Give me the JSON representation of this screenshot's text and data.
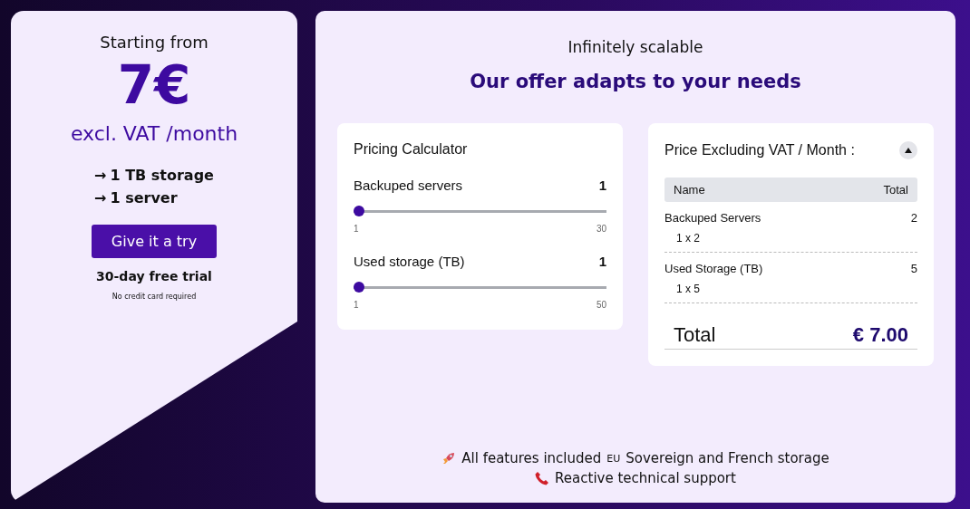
{
  "offer_card": {
    "intro": "Starting from",
    "price": "7€",
    "period": "excl. VAT /month",
    "features": [
      {
        "arrow": "→",
        "text": "1 TB storage"
      },
      {
        "arrow": "→",
        "text": "1 server"
      }
    ],
    "button": "Give it a try",
    "trial": "30-day free trial",
    "note": "No credit card required"
  },
  "main": {
    "subtitle": "Infinitely scalable",
    "title": "Our offer adapts to your needs"
  },
  "calculator": {
    "title": "Pricing Calculator",
    "sliders": [
      {
        "label": "Backuped servers",
        "value": "1",
        "level": 0,
        "min": "1",
        "max": "30"
      },
      {
        "label": "Used storage (TB)",
        "value": "1",
        "level": 0,
        "min": "1",
        "max": "50"
      }
    ]
  },
  "summary": {
    "title": "Price Excluding VAT / Month :",
    "expanded": true,
    "columns": [
      "Name",
      "Total"
    ],
    "rows": [
      {
        "name": "Backuped Servers",
        "detail": "1 x 2",
        "total": "2"
      },
      {
        "name": "Used Storage (TB)",
        "detail": "1 x 5",
        "total": "5"
      }
    ],
    "total_label": "Total",
    "total_value": "€ 7.00"
  },
  "footer": {
    "line_1": [
      {
        "kind": "rocket",
        "text": "All features included"
      },
      {
        "kind": "eu",
        "text": "EU"
      },
      {
        "kind": "plain",
        "text": "Sovereign and French storage"
      }
    ],
    "line_2": [
      {
        "kind": "phone",
        "text": "Reactive technical support"
      }
    ]
  }
}
